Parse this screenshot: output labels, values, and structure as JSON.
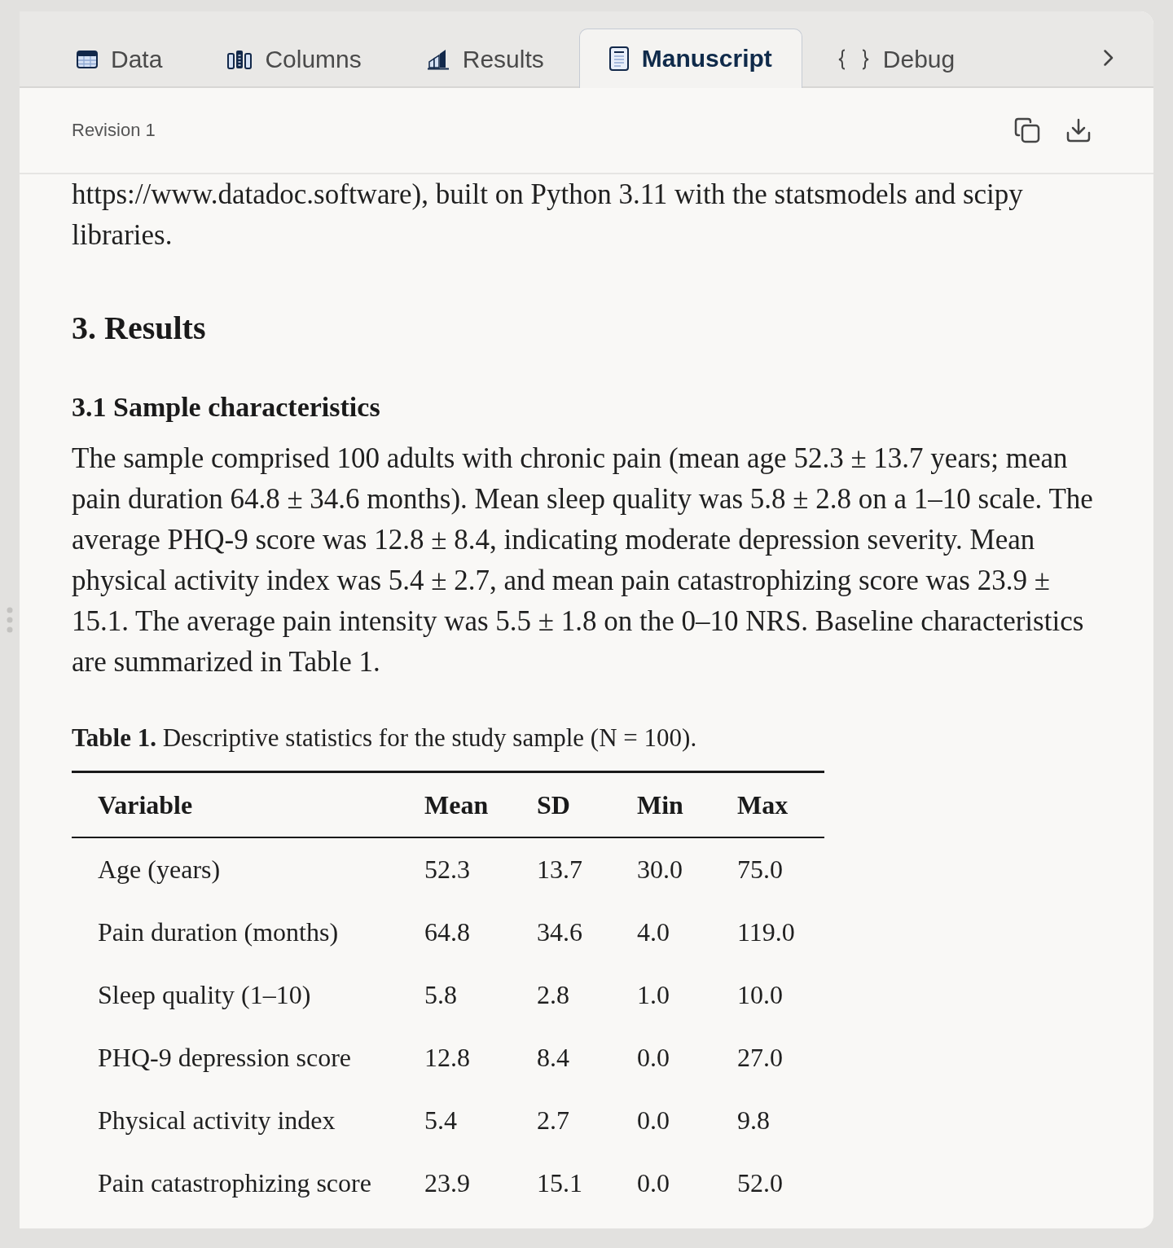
{
  "tabs": [
    {
      "label": "Data",
      "selected": false
    },
    {
      "label": "Columns",
      "selected": false
    },
    {
      "label": "Results",
      "selected": false
    },
    {
      "label": "Manuscript",
      "selected": true
    },
    {
      "label": "Debug",
      "selected": false
    }
  ],
  "toolbar": {
    "revision": "Revision 1"
  },
  "document": [
    {
      "kind": "paragraph",
      "text": "https://www.datadoc.software), built on Python 3.11 with the statsmodels and scipy libraries."
    },
    {
      "kind": "heading",
      "text": "3. Results"
    },
    {
      "kind": "subheading",
      "text": "3.1 Sample characteristics"
    },
    {
      "kind": "paragraph",
      "text": "The sample comprised 100 adults with chronic pain (mean age 52.3 ± 13.7 years; mean pain duration 64.8 ± 34.6 months). Mean sleep quality was 5.8 ± 2.8 on a 1–10 scale. The average PHQ-9 score was 12.8 ± 8.4, indicating moderate depression severity. Mean physical activity index was 5.4 ± 2.7, and mean pain catastrophizing score was 23.9 ± 15.1. The average pain intensity was 5.5 ± 1.8 on the 0–10 NRS. Baseline characteristics are summarized in Table 1."
    },
    {
      "kind": "table",
      "caption": "**Table 1.** Descriptive statistics for the study sample (N = 100).",
      "columns": [
        "Variable",
        "Mean",
        "SD",
        "Min",
        "Max"
      ],
      "rows": [
        [
          "Age (years)",
          "52.3",
          "13.7",
          "30.0",
          "75.0"
        ],
        [
          "Pain duration (months)",
          "64.8",
          "34.6",
          "4.0",
          "119.0"
        ],
        [
          "Sleep quality (1–10)",
          "5.8",
          "2.8",
          "1.0",
          "10.0"
        ],
        [
          "PHQ-9 depression score",
          "12.8",
          "8.4",
          "0.0",
          "27.0"
        ],
        [
          "Physical activity index",
          "5.4",
          "2.7",
          "0.0",
          "9.8"
        ],
        [
          "Pain catastrophizing score",
          "23.9",
          "15.1",
          "0.0",
          "52.0"
        ]
      ]
    }
  ]
}
